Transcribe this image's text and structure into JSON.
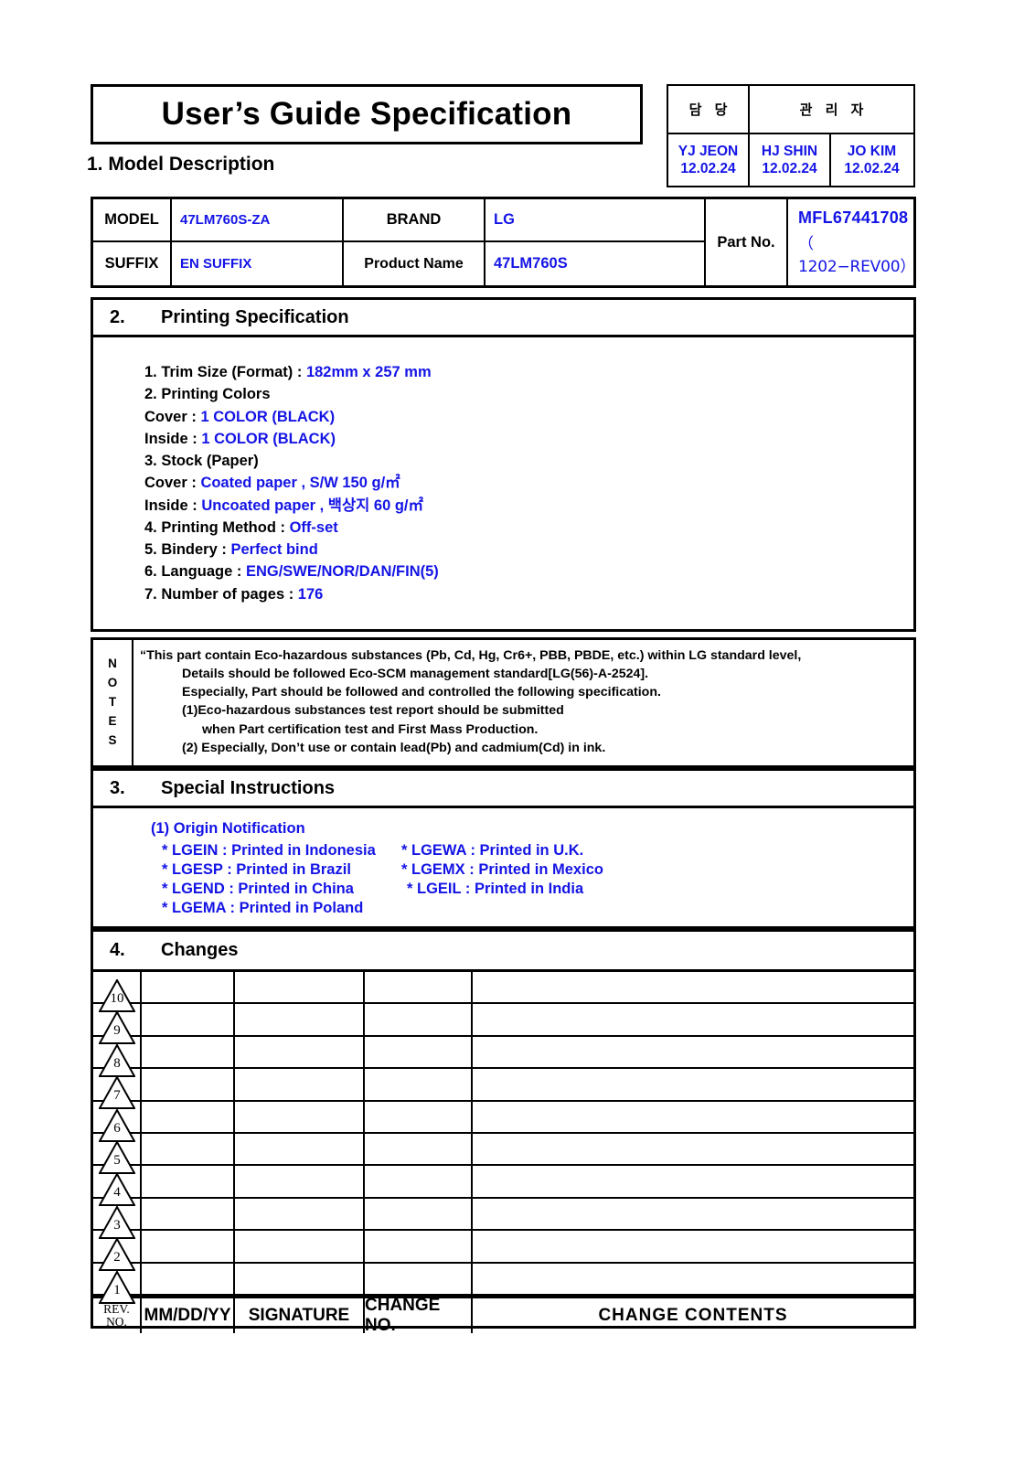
{
  "document": {
    "title": "User’s Guide Specification"
  },
  "approval": {
    "col_headers": [
      "담  당",
      "관 리 자"
    ],
    "approvers": [
      {
        "name": "YJ JEON",
        "date": "12.02.24"
      },
      {
        "name": "HJ SHIN",
        "date": "12.02.24"
      },
      {
        "name": "JO KIM",
        "date": "12.02.24"
      }
    ]
  },
  "section1": {
    "number": "1.",
    "heading": "Model Description",
    "fields": {
      "model_label": "MODEL",
      "model_value": "47LM760S-ZA",
      "brand_label": "BRAND",
      "brand_value": "LG",
      "suffix_label": "SUFFIX",
      "suffix_value": "EN SUFFIX",
      "product_name_label": "Product Name",
      "product_name_value": "47LM760S",
      "part_no_label": "Part No.",
      "part_no_value": "MFL67441708",
      "part_no_rev": "（ 1202−REV00）"
    }
  },
  "section2": {
    "number": "2.",
    "heading": "Printing Specification",
    "items": [
      {
        "label": "1. Trim Size (Format) : ",
        "value": "182mm x 257 mm"
      },
      {
        "label": "2. Printing Colors",
        "value": ""
      },
      {
        "label": " Cover : ",
        "value": "1 COLOR (BLACK)"
      },
      {
        "label": " Inside : ",
        "value": "1 COLOR (BLACK)"
      },
      {
        "label": "3. Stock (Paper)",
        "value": ""
      },
      {
        "label": " Cover : ",
        "value": "Coated paper , S/W 150 g/㎡"
      },
      {
        "label": " Inside : ",
        "value": "Uncoated paper , 백상지 60 g/㎡"
      },
      {
        "label": "4. Printing Method : ",
        "value": "Off-set"
      },
      {
        "label": "5. Bindery  : ",
        "value": "Perfect bind"
      },
      {
        "label": "6. Language : ",
        "value": "ENG/SWE/NOR/DAN/FIN(5)"
      },
      {
        "label": "7. Number of pages : ",
        "value": "176"
      }
    ]
  },
  "notes": {
    "label_letters": [
      "N",
      "O",
      "T",
      "E",
      "S"
    ],
    "lines": [
      "“This part contain Eco-hazardous substances (Pb, Cd, Hg, Cr6+, PBB, PBDE, etc.) within LG standard level,",
      "Details should be followed Eco-SCM management standard[LG(56)-A-2524].",
      "Especially, Part should be followed and controlled the following specification.",
      "(1)Eco-hazardous substances test report should be submitted",
      "when  Part certification test and First Mass Production.",
      "(2) Especially, Don’t use or contain lead(Pb) and cadmium(Cd) in ink."
    ]
  },
  "section3": {
    "number": "3.",
    "heading": "Special Instructions",
    "origin_title": "(1) Origin Notification",
    "origin_rows": [
      {
        "left": "* LGEIN : Printed in Indonesia",
        "right": "* LGEWA : Printed in U.K."
      },
      {
        "left": "* LGESP : Printed in Brazil",
        "right": "* LGEMX : Printed in Mexico"
      },
      {
        "left": "* LGEND : Printed in China",
        "right": "* LGEIL : Printed in India"
      },
      {
        "left": "* LGEMA : Printed in Poland",
        "right": ""
      }
    ]
  },
  "section4": {
    "number": "4.",
    "heading": "Changes",
    "rev_numbers": [
      "10",
      "9",
      "8",
      "7",
      "6",
      "5",
      "4",
      "3",
      "2",
      "1"
    ],
    "rows": [
      {
        "date": "",
        "signature": "",
        "change_no": "",
        "change_contents": ""
      },
      {
        "date": "",
        "signature": "",
        "change_no": "",
        "change_contents": ""
      },
      {
        "date": "",
        "signature": "",
        "change_no": "",
        "change_contents": ""
      },
      {
        "date": "",
        "signature": "",
        "change_no": "",
        "change_contents": ""
      },
      {
        "date": "",
        "signature": "",
        "change_no": "",
        "change_contents": ""
      },
      {
        "date": "",
        "signature": "",
        "change_no": "",
        "change_contents": ""
      },
      {
        "date": "",
        "signature": "",
        "change_no": "",
        "change_contents": ""
      },
      {
        "date": "",
        "signature": "",
        "change_no": "",
        "change_contents": ""
      },
      {
        "date": "",
        "signature": "",
        "change_no": "",
        "change_contents": ""
      },
      {
        "date": "",
        "signature": "",
        "change_no": "",
        "change_contents": ""
      }
    ],
    "footer": {
      "rev_line1": "REV.",
      "rev_line2": "NO.",
      "date": "MM/DD/YY",
      "signature": "SIGNATURE",
      "change_no": "CHANGE NO.",
      "change_contents": "CHANGE   CONTENTS"
    }
  },
  "colors": {
    "value_blue": "#1414e6",
    "ink_black": "#000000",
    "paper": "#ffffff"
  }
}
